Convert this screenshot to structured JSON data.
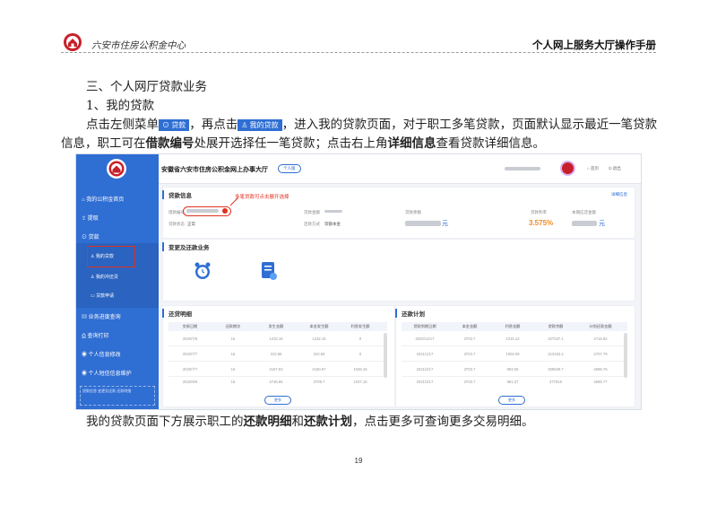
{
  "header": {
    "org_name": "六安市住房公积金中心",
    "doc_title": "个人网上服务大厅操作手册"
  },
  "body": {
    "section_heading": "三、个人网厅贷款业务",
    "subsection_heading": "1、我的贷款",
    "para1_a": "点击左侧菜单",
    "inline_btn1": "贷款",
    "para1_b": "，再点击",
    "inline_btn2": "我的贷款",
    "para1_c": "，进入我的贷款页面，对于职工多笔贷款，页面默认显示最近一笔贷款",
    "para2_a": "信息，职工可在",
    "para2_bold1": "借款编号",
    "para2_b": "处展开选择任一笔贷款；点击右上角",
    "para2_bold2": "详细信息",
    "para2_c": "查看贷款详细信息。",
    "para3_a": "我的贷款页面下方展示职工的",
    "para3_bold1": "还款明细",
    "para3_b": "和",
    "para3_bold2": "还款计划",
    "para3_c": "，点击更多可查询更多交易明细。"
  },
  "screenshot": {
    "app_title": "安徽省六安市住房公积金网上办事大厅",
    "app_badge": "个人版",
    "topbar_links": [
      "⌂ 首页",
      "⏻ 退出"
    ],
    "sidebar": {
      "items": [
        {
          "icon": "home-icon",
          "label": "我的公积金首页"
        },
        {
          "icon": "withdraw-icon",
          "label": "提取"
        },
        {
          "icon": "loan-icon",
          "label": "贷款"
        },
        {
          "icon": "user-icon",
          "label": "我的贷款"
        },
        {
          "icon": "user-icon",
          "label": "我的冲还贷"
        },
        {
          "icon": "doc-icon",
          "label": "贷款申请"
        },
        {
          "icon": "progress-icon",
          "label": "业务进度查询"
        },
        {
          "icon": "print-icon",
          "label": "查询打印"
        },
        {
          "icon": "info-icon",
          "label": "个人信息修改"
        },
        {
          "icon": "phone-icon",
          "label": "个人短信信息维护"
        }
      ],
      "footer_text": "贷款信息 变更及还款 还款明细"
    },
    "loan_info": {
      "title": "贷款信息",
      "detail_link": "详细信息",
      "annotation": "多笔贷款可点击展开选择",
      "loan_no_label": "借款编号",
      "amount_label": "贷款金额",
      "status_label": "贷款状态",
      "status_value": "正常",
      "repay_label": "还款方式",
      "repay_value": "等额本金",
      "balance_label": "贷款余额",
      "balance_unit": "元",
      "rate_label": "贷款利率",
      "rate_value": "3.575%",
      "due_label": "本期应还金额",
      "due_unit": "元"
    },
    "change_section": {
      "title": "变更及还款业务"
    },
    "repay_detail": {
      "title": "还贷明细",
      "columns": [
        "交易日期",
        "还款期次",
        "发生金额",
        "本金发生额",
        "利息发生额"
      ],
      "rows": [
        [
          "2020/7/6",
          "16",
          "1232.16",
          "1232.16",
          "0"
        ],
        [
          "2020/7/7",
          "16",
          "310.65",
          "310.65",
          "0"
        ],
        [
          "2020/7/7",
          "16",
          "3187.83",
          "2160.87",
          "1026.16"
        ],
        [
          "2020/8/6",
          "15",
          "4746.85",
          "3709.7",
          "1037.16"
        ]
      ],
      "more": "更多"
    },
    "repay_plan": {
      "title": "还款计划",
      "columns": [
        "贷款到期日期",
        "本金金额",
        "利息金额",
        "贷款余额",
        "计划还款金额"
      ],
      "rows": [
        [
          "2020/12/17",
          "3703.7",
          "1015.12",
          "327037.1",
          "4718.82"
        ],
        [
          "2021/1/17",
          "3703.7",
          "1004.09",
          "313333.4",
          "4707.79"
        ],
        [
          "2021/2/17",
          "3703.7",
          "993.06",
          "309629.7",
          "4696.76"
        ],
        [
          "2021/3/17",
          "3703.7",
          "981.37",
          "377919",
          "4685.77"
        ]
      ],
      "more": "更多"
    }
  },
  "footer": {
    "page_number": "19"
  },
  "colors": {
    "accent": "#2f6ed3",
    "logo_red": "#c8202a",
    "annotation_red": "#e03020"
  }
}
